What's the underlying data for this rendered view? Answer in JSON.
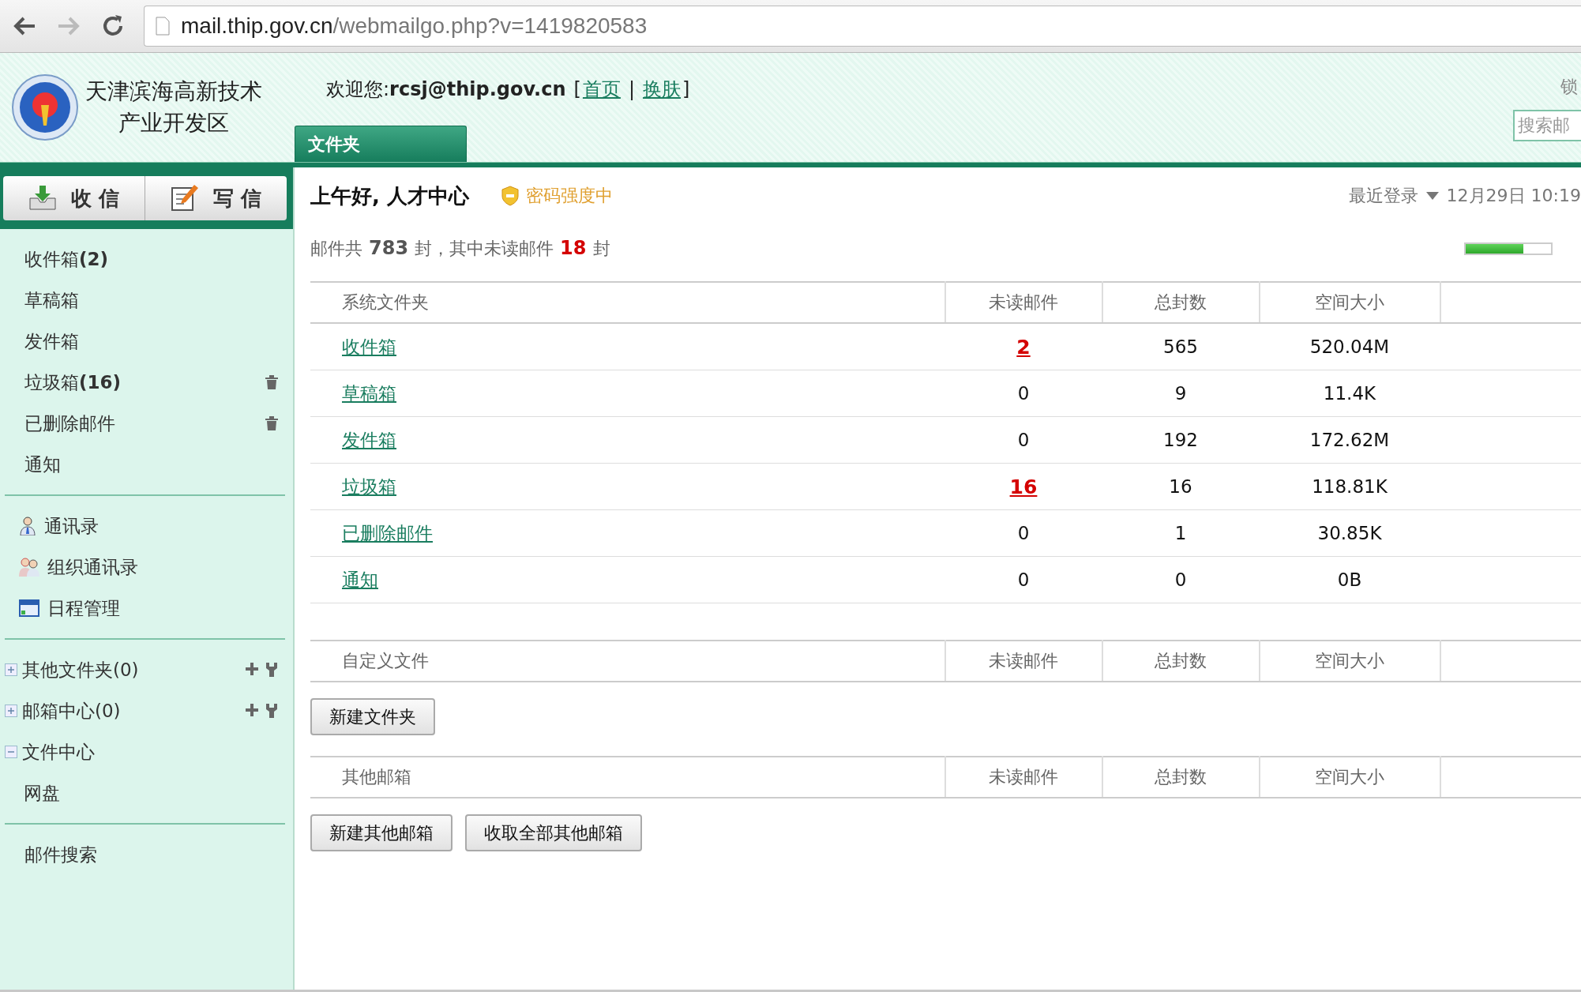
{
  "browser": {
    "url_host": "mail.thip.gov.cn",
    "url_path": "/webmailgo.php?v=1419820583"
  },
  "header": {
    "org_name": [
      "天津滨海高新技术",
      "产业开发区"
    ],
    "welcome_label": "欢迎您:",
    "user": "rcsj@thip.gov.cn",
    "link_open": "[",
    "links": [
      "首页",
      "换肤"
    ],
    "link_separator": "|",
    "link_close": "]",
    "lock": "锁",
    "search": {
      "placeholder": "搜索邮"
    },
    "tabs": [
      {
        "label": "文件夹",
        "selected": true
      }
    ]
  },
  "actions": [
    "收 信",
    "写 信"
  ],
  "sidebar": {
    "sections": [
      [
        {
          "kind": "folder",
          "label": "收件箱**(2)**",
          "trash": false
        },
        {
          "kind": "folder",
          "label": "草稿箱",
          "trash": false
        },
        {
          "kind": "folder",
          "label": "发件箱",
          "trash": false
        },
        {
          "kind": "folder",
          "label": "垃圾箱**(16)**",
          "trash": true
        },
        {
          "kind": "folder",
          "label": "已删除邮件",
          "trash": true
        },
        {
          "kind": "folder",
          "label": "通知",
          "trash": false
        }
      ],
      [
        {
          "kind": "contact",
          "label": "通讯录"
        },
        {
          "kind": "group",
          "label": "组织通讯录"
        },
        {
          "kind": "calendar",
          "label": "日程管理"
        }
      ],
      [
        {
          "kind": "tree",
          "label": "其他文件夹(0)",
          "expanded": false,
          "tools": true
        },
        {
          "kind": "tree",
          "label": "邮箱中心(0)",
          "expanded": false,
          "tools": true
        },
        {
          "kind": "tree",
          "label": "文件中心",
          "expanded": true,
          "tools": false,
          "children": [
            {
              "kind": "folder",
              "label": "网盘",
              "trash": false
            }
          ]
        }
      ],
      [
        {
          "kind": "folder",
          "label": "邮件搜索",
          "trash": false
        }
      ]
    ]
  },
  "greeting": "上午好, 人才中心",
  "password_strength": "密码强度中",
  "last_login": {
    "label": "最近登录",
    "time": "12月29日 10:19"
  },
  "summary": {
    "prefix": "邮件共",
    "total": "783",
    "mid": "封，其中未读邮件",
    "unread": "18",
    "suffix": "封"
  },
  "storage": {
    "level": 0.68
  },
  "system_folders": {
    "columns": [
      "系统文件夹",
      "未读邮件",
      "总封数",
      "空间大小"
    ],
    "rows": [
      {
        "name": "收件箱",
        "unread": "2",
        "highlight": true,
        "total": "565",
        "size": "520.04M"
      },
      {
        "name": "草稿箱",
        "unread": "0",
        "highlight": false,
        "total": "9",
        "size": "11.4K"
      },
      {
        "name": "发件箱",
        "unread": "0",
        "highlight": false,
        "total": "192",
        "size": "172.62M"
      },
      {
        "name": "垃圾箱",
        "unread": "16",
        "highlight": true,
        "total": "16",
        "size": "118.81K"
      },
      {
        "name": "已删除邮件",
        "unread": "0",
        "highlight": false,
        "total": "1",
        "size": "30.85K"
      },
      {
        "name": "通知",
        "unread": "0",
        "highlight": false,
        "total": "0",
        "size": "0B"
      }
    ]
  },
  "custom_folders": {
    "columns": [
      "自定义文件",
      "未读邮件",
      "总封数",
      "空间大小"
    ],
    "buttons": [
      "新建文件夹"
    ]
  },
  "other_mailboxes": {
    "columns": [
      "其他邮箱",
      "未读邮件",
      "总封数",
      "空间大小"
    ],
    "buttons": [
      "新建其他邮箱",
      "收取全部其他邮箱"
    ]
  }
}
